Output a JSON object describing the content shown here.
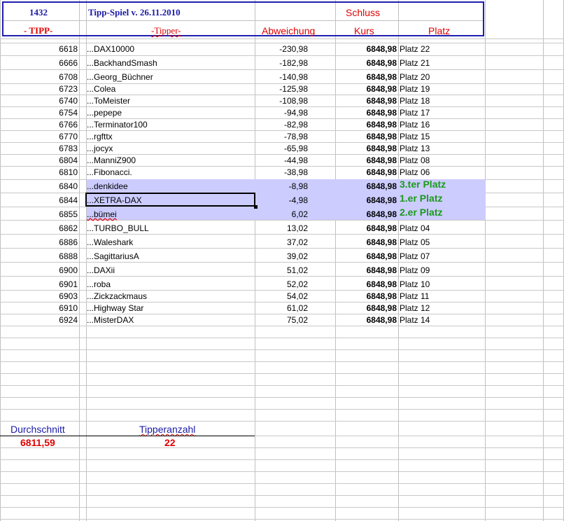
{
  "header": {
    "number": "1432",
    "title": "Tipp-Spiel v. 26.11.2010",
    "schluss": "Schluss",
    "col_tipp": "- TIPP-",
    "col_tipper": "-Tipper-",
    "col_abweichung": "Abweichung",
    "col_kurs": "Kurs",
    "col_platz": "Platz"
  },
  "rows": [
    {
      "tipp": "6618",
      "name": "...DAX10000",
      "abw": "-230,98",
      "kurs": "6848,98",
      "platz": "Platz 22"
    },
    {
      "tipp": "6666",
      "name": "...BackhandSmash",
      "abw": "-182,98",
      "kurs": "6848,98",
      "platz": "Platz 21"
    },
    {
      "tipp": "6708",
      "name": "...Georg_Büchner",
      "abw": "-140,98",
      "kurs": "6848,98",
      "platz": "Platz 20"
    },
    {
      "tipp": "6723",
      "name": "...Colea",
      "abw": "-125,98",
      "kurs": "6848,98",
      "platz": "Platz 19"
    },
    {
      "tipp": "6740",
      "name": "...ToMeister",
      "abw": "-108,98",
      "kurs": "6848,98",
      "platz": "Platz 18"
    },
    {
      "tipp": "6754",
      "name": "...pepepe",
      "abw": "-94,98",
      "kurs": "6848,98",
      "platz": "Platz 17"
    },
    {
      "tipp": "6766",
      "name": "...Terminator100",
      "abw": "-82,98",
      "kurs": "6848,98",
      "platz": "Platz 16"
    },
    {
      "tipp": "6770",
      "name": "...rgfttx",
      "abw": "-78,98",
      "kurs": "6848,98",
      "platz": "Platz 15"
    },
    {
      "tipp": "6783",
      "name": "...jocyx",
      "abw": "-65,98",
      "kurs": "6848,98",
      "platz": "Platz 13"
    },
    {
      "tipp": "6804",
      "name": "...ManniZ900",
      "abw": "-44,98",
      "kurs": "6848,98",
      "platz": "Platz 08"
    },
    {
      "tipp": "6810",
      "name": "...Fibonacci.",
      "abw": "-38,98",
      "kurs": "6848,98",
      "platz": "Platz 06"
    },
    {
      "tipp": "6840",
      "name": "...denkidee",
      "abw": "-8,98",
      "kurs": "6848,98",
      "platz": "3.ter Platz"
    },
    {
      "tipp": "6844",
      "name": "...XETRA-DAX",
      "abw": "-4,98",
      "kurs": "6848,98",
      "platz": "1.er Platz"
    },
    {
      "tipp": "6855",
      "name": "...bümei",
      "abw": "6,02",
      "kurs": "6848,98",
      "platz": "2.er Platz"
    },
    {
      "tipp": "6862",
      "name": "...TURBO_BULL",
      "abw": "13,02",
      "kurs": "6848,98",
      "platz": "Platz 04"
    },
    {
      "tipp": "6886",
      "name": "...Waleshark",
      "abw": "37,02",
      "kurs": "6848,98",
      "platz": "Platz 05"
    },
    {
      "tipp": "6888",
      "name": "...SagittariusA",
      "abw": "39,02",
      "kurs": "6848,98",
      "platz": "Platz 07"
    },
    {
      "tipp": "6900",
      "name": "...DAXii",
      "abw": "51,02",
      "kurs": "6848,98",
      "platz": "Platz 09"
    },
    {
      "tipp": "6901",
      "name": "...roba",
      "abw": "52,02",
      "kurs": "6848,98",
      "platz": "Platz 10"
    },
    {
      "tipp": "6903",
      "name": "...Zickzackmaus",
      "abw": "54,02",
      "kurs": "6848,98",
      "platz": "Platz 11"
    },
    {
      "tipp": "6910",
      "name": "...Highway Star",
      "abw": "61,02",
      "kurs": "6848,98",
      "platz": "Platz 12"
    },
    {
      "tipp": "6924",
      "name": "...MisterDAX",
      "abw": "75,02",
      "kurs": "6848,98",
      "platz": "Platz 14"
    }
  ],
  "summary": {
    "avg_label": "Durchschnitt",
    "avg_value": "6811,59",
    "count_label": "Tipperanzahl",
    "count_value": "22"
  },
  "colors": {
    "highlight": "#ccccff",
    "header_border": "#1f1fb0",
    "red": "#e10000",
    "green": "#1a9a1a"
  }
}
